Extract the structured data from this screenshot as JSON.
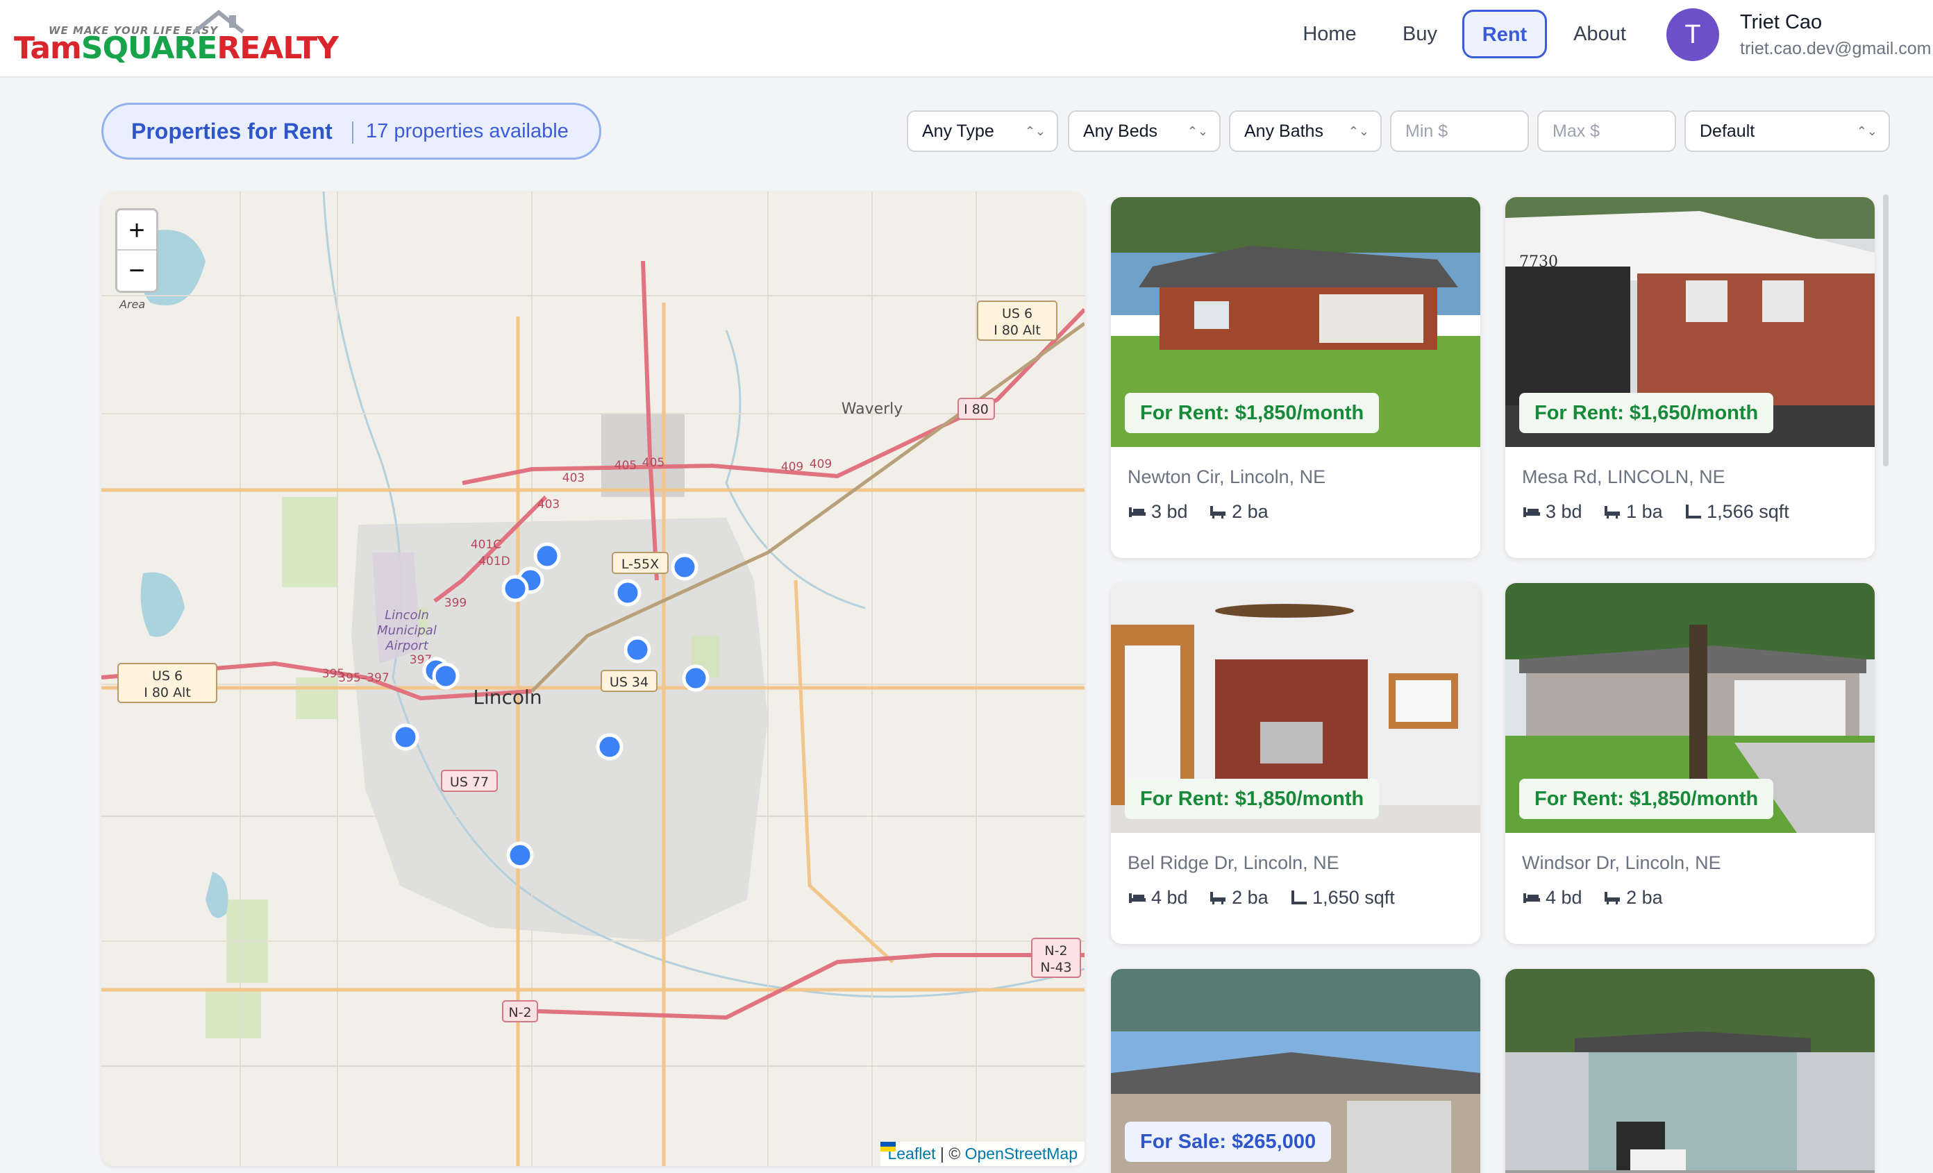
{
  "header": {
    "logo_tagline": "WE MAKE YOUR LIFE EASY",
    "logo_name_1": "Tam",
    "logo_name_2": "SQUARE",
    "logo_name_3": "REALTY",
    "nav": [
      "Home",
      "Buy",
      "Rent",
      "About"
    ],
    "active_nav": "Rent",
    "user": {
      "initial": "T",
      "name": "Triet Cao",
      "email": "triet.cao.dev@gmail.com"
    }
  },
  "toolbar": {
    "title": "Properties for Rent",
    "count": "17 properties available",
    "type_select": "Any Type",
    "beds_select": "Any Beds",
    "baths_select": "Any Baths",
    "min_price_placeholder": "Min $",
    "max_price_placeholder": "Max $",
    "sort_select": "Default"
  },
  "map": {
    "zoom_in": "+",
    "zoom_out": "−",
    "attribution_leaflet": "Leaflet",
    "attribution_sep": "| ©",
    "attribution_osm": "OpenStreetMap",
    "labels": [
      "Lincoln",
      "Waverly",
      "Lincoln Municipal Airport",
      "US 6",
      "I 80 Alt",
      "I 80",
      "US 34",
      "US 77",
      "L-55X",
      "N-2",
      "N-43",
      "405",
      "409",
      "403",
      "401D",
      "401C",
      "399",
      "395",
      "397",
      "Area"
    ],
    "marker_count": 13
  },
  "listings": [
    {
      "price": "For Rent: $1,850/month",
      "address": "Newton Cir, Lincoln, NE",
      "beds": "3 bd",
      "baths": "2 ba",
      "sqft": ""
    },
    {
      "price": "For Rent: $1,650/month",
      "address": "Mesa Rd, LINCOLN, NE",
      "beds": "3 bd",
      "baths": "1 ba",
      "sqft": "1,566 sqft"
    },
    {
      "price": "For Rent: $1,850/month",
      "address": "Bel Ridge Dr, Lincoln, NE",
      "beds": "4 bd",
      "baths": "2 ba",
      "sqft": "1,650 sqft"
    },
    {
      "price": "For Rent: $1,850/month",
      "address": "Windsor Dr, Lincoln, NE",
      "beds": "4 bd",
      "baths": "2 ba",
      "sqft": ""
    },
    {
      "price": "For Sale: $265,000",
      "address": "",
      "beds": "",
      "baths": "",
      "sqft": ""
    },
    {
      "price": "",
      "address": "",
      "beds": "",
      "baths": "",
      "sqft": ""
    }
  ],
  "colors": {
    "brand_red": "#d9262c",
    "brand_green": "#16a34a",
    "accent": "#3b5bdb",
    "rent_green": "#178a3a",
    "marker": "#3b82f6"
  }
}
